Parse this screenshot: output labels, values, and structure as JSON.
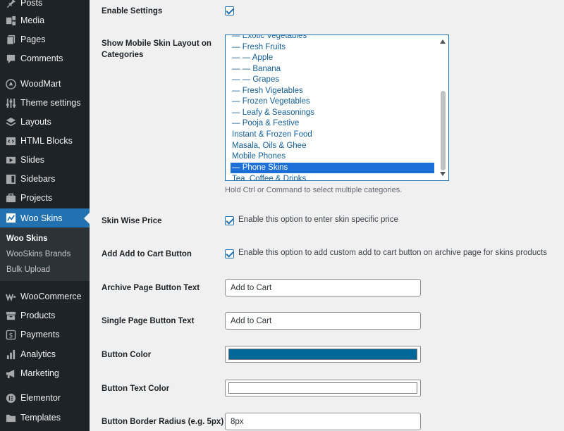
{
  "sidebar": {
    "items": [
      {
        "label": "Posts",
        "icon": "pin-icon"
      },
      {
        "label": "Media",
        "icon": "media-icon"
      },
      {
        "label": "Pages",
        "icon": "pages-icon"
      },
      {
        "label": "Comments",
        "icon": "comments-icon"
      },
      {
        "label": "WoodMart",
        "icon": "woodmart-icon"
      },
      {
        "label": "Theme settings",
        "icon": "sliders-icon"
      },
      {
        "label": "Layouts",
        "icon": "layers-icon"
      },
      {
        "label": "HTML Blocks",
        "icon": "html-block-icon"
      },
      {
        "label": "Slides",
        "icon": "slides-icon"
      },
      {
        "label": "Sidebars",
        "icon": "sidebar-icon"
      },
      {
        "label": "Projects",
        "icon": "briefcase-icon"
      },
      {
        "label": "Woo Skins",
        "icon": "chart-icon"
      },
      {
        "label": "WooCommerce",
        "icon": "woocommerce-icon"
      },
      {
        "label": "Products",
        "icon": "archive-icon"
      },
      {
        "label": "Payments",
        "icon": "payments-icon"
      },
      {
        "label": "Analytics",
        "icon": "bar-chart-icon"
      },
      {
        "label": "Marketing",
        "icon": "megaphone-icon"
      },
      {
        "label": "Elementor",
        "icon": "elementor-icon"
      },
      {
        "label": "Templates",
        "icon": "folder-icon"
      }
    ],
    "submenu": [
      {
        "label": "Woo Skins"
      },
      {
        "label": "WooSkins Brands"
      },
      {
        "label": "Bulk Upload"
      }
    ],
    "accent_color": "#2271b1",
    "background_color": "#1d2327"
  },
  "settings": {
    "enable_settings": {
      "label": "Enable Settings",
      "checked": true
    },
    "show_mobile": {
      "label": "Show Mobile Skin Layout on Categories",
      "options": [
        "— Exotic Vegetables",
        "— Fresh Fruits",
        "— — Apple",
        "— — Banana",
        "— — Grapes",
        "— Fresh Vigetables",
        "— Frozen Vegetables",
        "— Leafy & Seasonings",
        "— Pooja & Festive",
        "Instant & Frozen Food",
        "Masala, Oils & Ghee",
        "Mobile Phones",
        "— Phone Skins",
        "Tea, Coffee & Drinks"
      ],
      "selected": "— Phone Skins",
      "hint": "Hold Ctrl or Command to select multiple categories."
    },
    "skin_wise_price": {
      "label": "Skin Wise Price",
      "text": "Enable this option to enter skin specific price",
      "checked": true
    },
    "add_to_cart": {
      "label": "Add Add to Cart Button",
      "text": "Enable this option to add custom add to cart button on archive page for skins products",
      "checked": true
    },
    "archive_button_text": {
      "label": "Archive Page Button Text",
      "value": "Add to Cart"
    },
    "single_button_text": {
      "label": "Single Page Button Text",
      "value": "Add to Cart"
    },
    "button_color": {
      "label": "Button Color",
      "value": "#006799"
    },
    "button_text_color": {
      "label": "Button Text Color",
      "value": "#ffffff"
    },
    "button_border_radius": {
      "label": "Button Border Radius (e.g. 5px)",
      "value": "8px"
    }
  }
}
